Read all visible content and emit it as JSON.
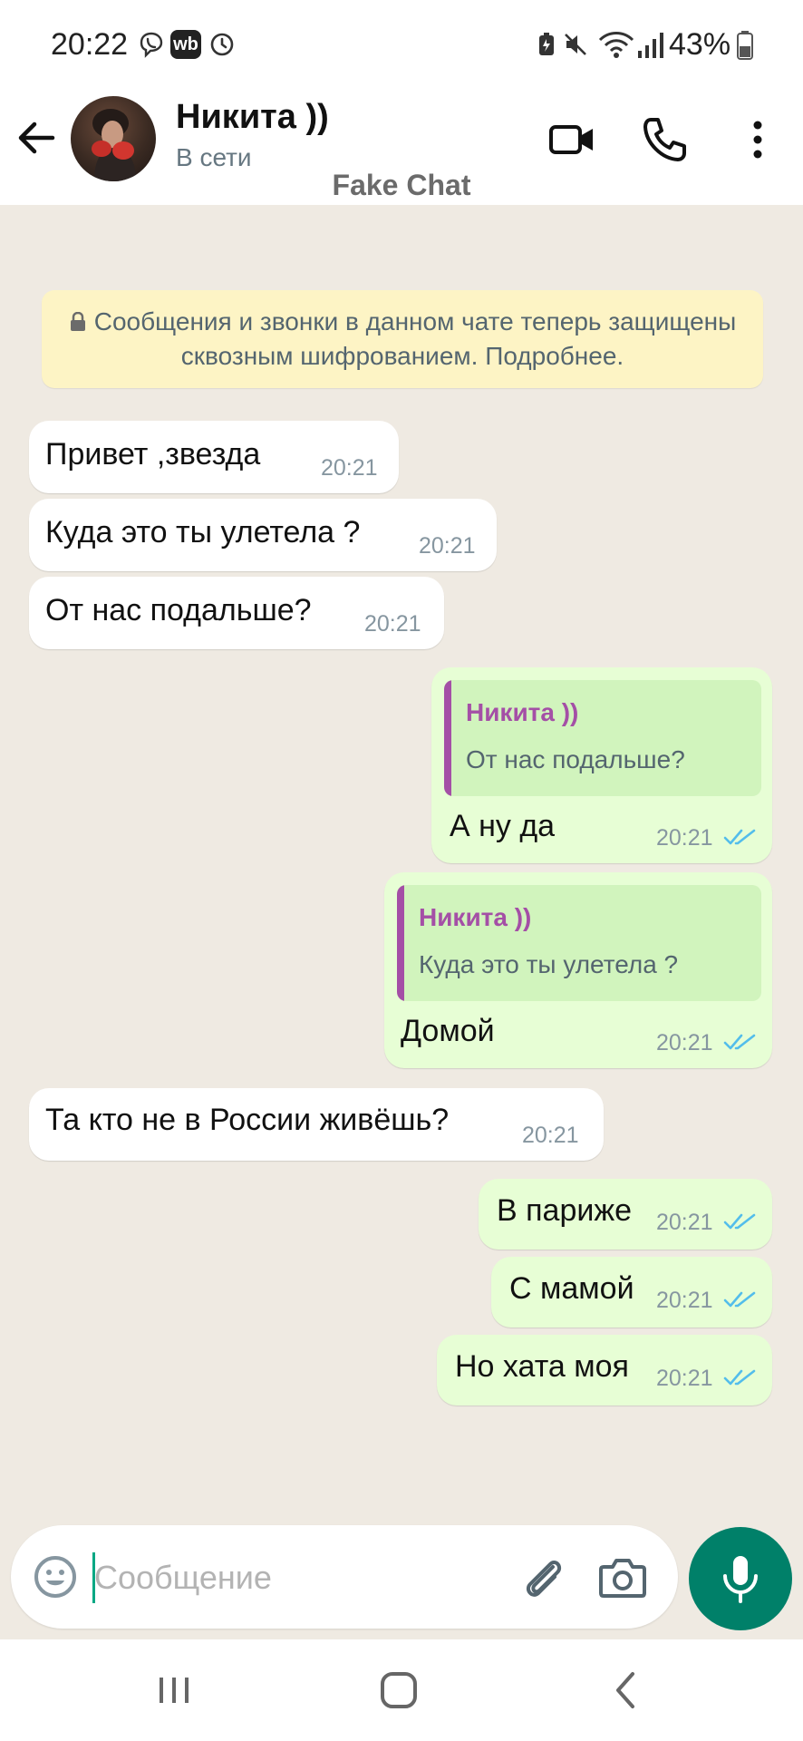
{
  "status_bar": {
    "time": "20:22",
    "battery_percent": "43%",
    "icons": [
      "viber-icon",
      "wb-icon",
      "alarm-clock-icon",
      "battery-saver-icon",
      "mute-icon",
      "wifi-icon",
      "signal-icon",
      "battery-icon"
    ],
    "wb_badge": "wb"
  },
  "header": {
    "contact_name": "Никита ))",
    "contact_status": "В сети",
    "watermark": "Fake Chat",
    "icons": [
      "back-arrow-icon",
      "video-call-icon",
      "phone-icon",
      "more-vert-icon"
    ]
  },
  "notice": {
    "text": "Сообщения и звонки в данном чате теперь защищены сквозным шифрованием. Подробнее."
  },
  "messages": [
    {
      "direction": "in",
      "text": "Привет ,звезда",
      "time": "20:21"
    },
    {
      "direction": "in",
      "text": "Куда это ты улетела ?",
      "time": "20:21"
    },
    {
      "direction": "in",
      "text": "От нас подальше?",
      "time": "20:21"
    },
    {
      "direction": "out",
      "text": "А ну да",
      "time": "20:21",
      "status": "read",
      "quote": {
        "author": "Никита ))",
        "text": "От нас подальше?"
      }
    },
    {
      "direction": "out",
      "text": "Домой",
      "time": "20:21",
      "status": "read",
      "quote": {
        "author": "Никита ))",
        "text": "Куда это ты улетела ?"
      }
    },
    {
      "direction": "in",
      "text": "Та кто не в России живёшь?",
      "time": "20:21"
    },
    {
      "direction": "out",
      "text": "В париже",
      "time": "20:21",
      "status": "read"
    },
    {
      "direction": "out",
      "text": "С мамой",
      "time": "20:21",
      "status": "read"
    },
    {
      "direction": "out",
      "text": "Но хата моя",
      "time": "20:21",
      "status": "read"
    }
  ],
  "composer": {
    "placeholder": "Сообщение",
    "value": "",
    "icons": [
      "emoji-icon",
      "attach-icon",
      "camera-icon",
      "mic-icon"
    ]
  },
  "colors": {
    "chat_background": "#efeae2",
    "incoming_bubble": "#ffffff",
    "outgoing_bubble": "#e7fed5",
    "quote_accent": "#a44fa6",
    "read_ticks": "#53bdeb",
    "accent": "#008069",
    "notice_background": "#fdf4c5"
  },
  "nav_bar": {
    "icons": [
      "recent-apps-icon",
      "home-icon",
      "back-icon"
    ]
  }
}
